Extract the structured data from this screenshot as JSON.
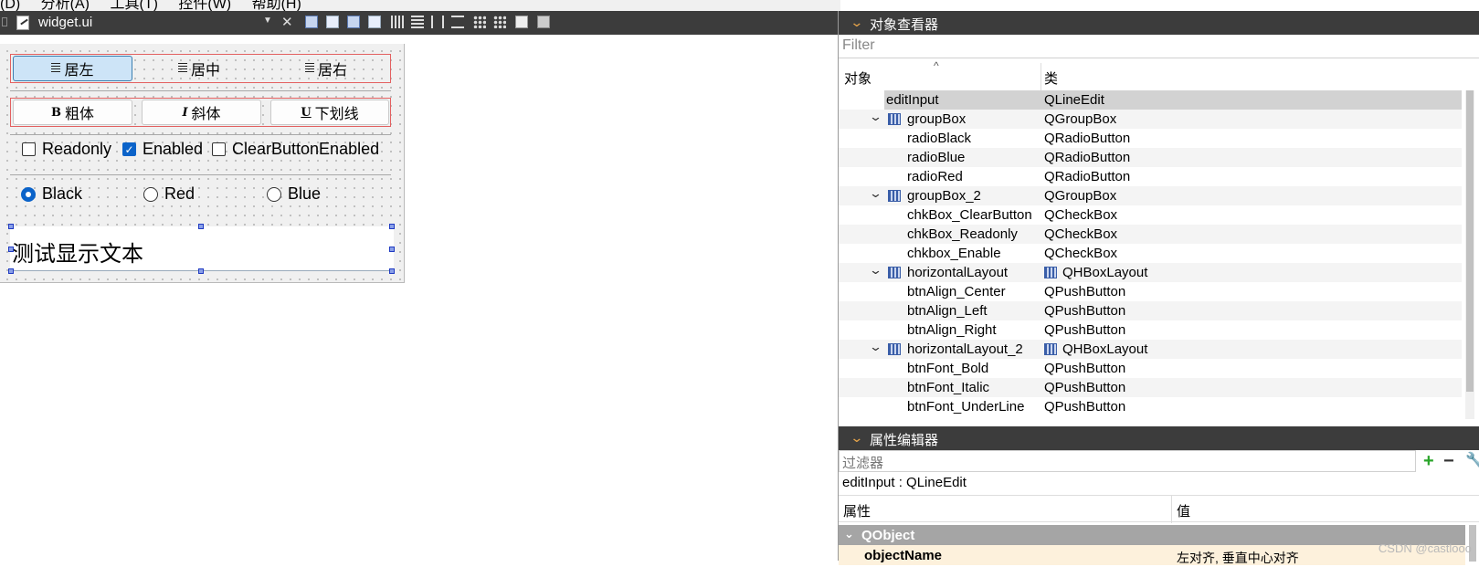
{
  "menubar": {
    "items": [
      "(D)",
      "分析(A)",
      "工具(T)",
      "控件(W)",
      "帮助(H)"
    ]
  },
  "editor": {
    "file_title": "widget.ui"
  },
  "form": {
    "align_buttons": [
      "居左",
      "居中",
      "居右"
    ],
    "font_buttons": [
      {
        "icon": "B",
        "label": "粗体"
      },
      {
        "icon": "I",
        "label": "斜体"
      },
      {
        "icon": "U",
        "label": "下划线"
      }
    ],
    "checkboxes": [
      {
        "label": "Readonly",
        "checked": false
      },
      {
        "label": "Enabled",
        "checked": true
      },
      {
        "label": "ClearButtonEnabled",
        "checked": false
      }
    ],
    "radios": [
      {
        "label": "Black",
        "checked": true
      },
      {
        "label": "Red",
        "checked": false
      },
      {
        "label": "Blue",
        "checked": false
      }
    ],
    "line_edit_text": "测试显示文本"
  },
  "object_inspector": {
    "title": "对象查看器",
    "filter_placeholder": "Filter",
    "col_object": "对象",
    "col_class": "类",
    "rows": [
      {
        "name": "editInput",
        "cls": "QLineEdit"
      },
      {
        "name": "groupBox",
        "cls": "QGroupBox"
      },
      {
        "name": "radioBlack",
        "cls": "QRadioButton"
      },
      {
        "name": "radioBlue",
        "cls": "QRadioButton"
      },
      {
        "name": "radioRed",
        "cls": "QRadioButton"
      },
      {
        "name": "groupBox_2",
        "cls": "QGroupBox"
      },
      {
        "name": "chkBox_ClearButton",
        "cls": "QCheckBox"
      },
      {
        "name": "chkBox_Readonly",
        "cls": "QCheckBox"
      },
      {
        "name": "chkbox_Enable",
        "cls": "QCheckBox"
      },
      {
        "name": "horizontalLayout",
        "cls": "QHBoxLayout"
      },
      {
        "name": "btnAlign_Center",
        "cls": "QPushButton"
      },
      {
        "name": "btnAlign_Left",
        "cls": "QPushButton"
      },
      {
        "name": "btnAlign_Right",
        "cls": "QPushButton"
      },
      {
        "name": "horizontalLayout_2",
        "cls": "QHBoxLayout"
      },
      {
        "name": "btnFont_Bold",
        "cls": "QPushButton"
      },
      {
        "name": "btnFont_Italic",
        "cls": "QPushButton"
      },
      {
        "name": "btnFont_UnderLine",
        "cls": "QPushButton"
      }
    ]
  },
  "property_editor": {
    "title": "属性编辑器",
    "filter_placeholder": "过滤器",
    "object_label": "editInput : QLineEdit",
    "col_property": "属性",
    "col_value": "值",
    "group": "QObject",
    "row_name": "objectName",
    "row_value": "左对齐, 垂直中心对齐"
  },
  "watermark": "CSDN @castlooo",
  "colors": {
    "accent_blue": "#0b63c9",
    "layout_red": "#e36060",
    "dock_title": "#3c3c3c",
    "property_highlight": "#fdf1dc"
  }
}
